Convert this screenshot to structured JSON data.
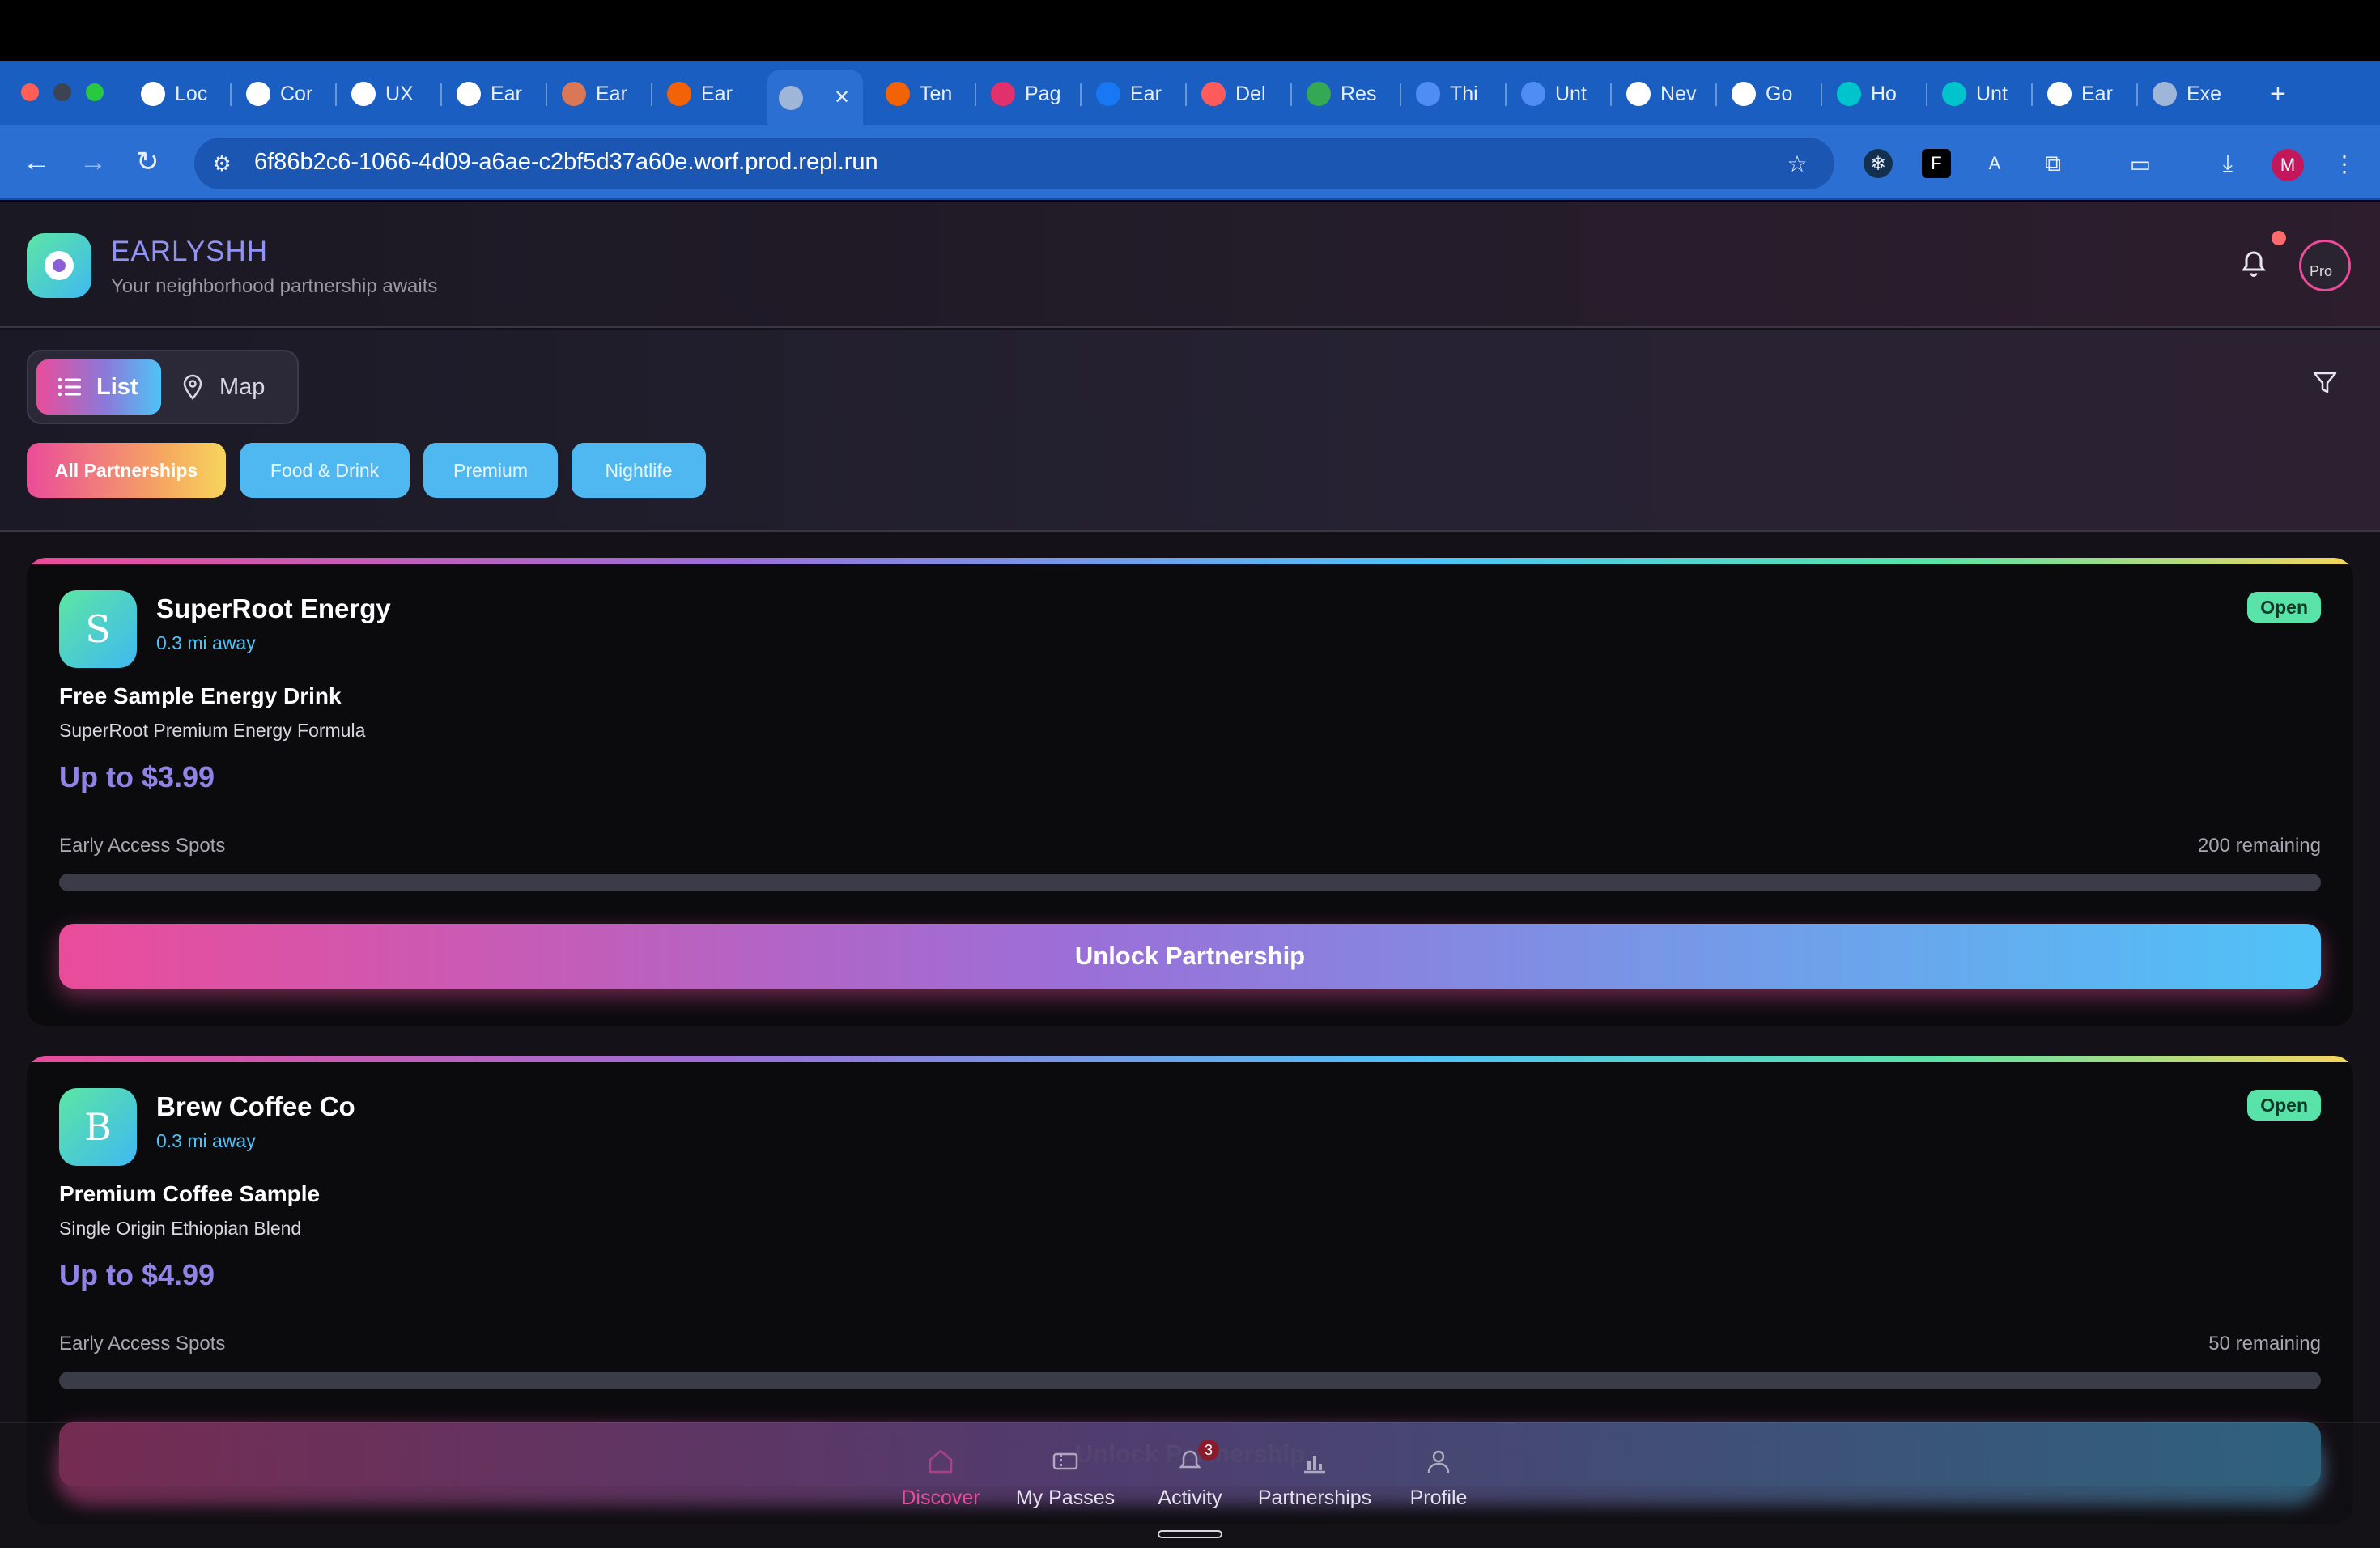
{
  "browser": {
    "tabs": [
      {
        "label": "Loc",
        "icon": "openai-icon"
      },
      {
        "label": "Cor",
        "icon": "openai-icon"
      },
      {
        "label": "UX",
        "icon": "openai-icon"
      },
      {
        "label": "Ear",
        "icon": "openai-icon"
      },
      {
        "label": "Ear",
        "icon": "claude-icon"
      },
      {
        "label": "Ear",
        "icon": "replit-icon"
      },
      {
        "label": "",
        "icon": "globe-icon",
        "active": true
      },
      {
        "label": "Ten",
        "icon": "replit-icon"
      },
      {
        "label": "Pag",
        "icon": "instagram-icon"
      },
      {
        "label": "Ear",
        "icon": "facebook-icon"
      },
      {
        "label": "Del",
        "icon": "heart-icon"
      },
      {
        "label": "Res",
        "icon": "drive-icon"
      },
      {
        "label": "Thi",
        "icon": "docs-icon"
      },
      {
        "label": "Unt",
        "icon": "docs-icon"
      },
      {
        "label": "Nev",
        "icon": "chrome-icon"
      },
      {
        "label": "Go",
        "icon": "key-icon"
      },
      {
        "label": "Ho",
        "icon": "canva-icon"
      },
      {
        "label": "Unt",
        "icon": "canva-icon"
      },
      {
        "label": "Ear",
        "icon": "wifi-icon"
      },
      {
        "label": "Exe",
        "icon": "globe-icon"
      }
    ],
    "url": "6f86b2c6-1066-4d09-a6ae-c2bf5d37a60e.worf.prod.repl.run",
    "profile_initial": "M"
  },
  "app": {
    "brand": "EARLYSHH",
    "tagline": "Your neighborhood partnership awaits",
    "avatar_alt": "Pro",
    "view_toggle": {
      "list": "List",
      "map": "Map"
    },
    "filters": [
      {
        "label": "All Partnerships",
        "active": true
      },
      {
        "label": "Food & Drink",
        "active": false
      },
      {
        "label": "Premium",
        "active": false
      },
      {
        "label": "Nightlife",
        "active": false
      }
    ],
    "cards": [
      {
        "initial": "S",
        "name": "SuperRoot Energy",
        "distance": "0.3 mi away",
        "status": "Open",
        "offer": "Free Sample Energy Drink",
        "description": "SuperRoot Premium Energy Formula",
        "price": "Up to $3.99",
        "spots_label": "Early Access Spots",
        "remaining": "200 remaining",
        "progress_fraction": 0,
        "cta": "Unlock Partnership"
      },
      {
        "initial": "B",
        "name": "Brew Coffee Co",
        "distance": "0.3 mi away",
        "status": "Open",
        "offer": "Premium Coffee Sample",
        "description": "Single Origin Ethiopian Blend",
        "price": "Up to $4.99",
        "spots_label": "Early Access Spots",
        "remaining": "50 remaining",
        "progress_fraction": 0,
        "cta": "Unlock Partnership"
      }
    ],
    "bottom_nav": [
      {
        "label": "Discover",
        "active": true
      },
      {
        "label": "My Passes",
        "active": false
      },
      {
        "label": "Activity",
        "active": false,
        "count": "3"
      },
      {
        "label": "Partnerships",
        "active": false
      },
      {
        "label": "Profile",
        "active": false
      }
    ],
    "colors": {
      "accent_pink": "#ea4c9a",
      "accent_blue": "#4fc3f7",
      "open_green": "#5ae3a8",
      "price_purple": "#8f83e6"
    }
  }
}
